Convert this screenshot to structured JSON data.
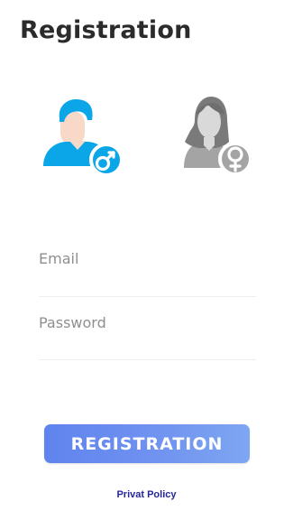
{
  "screen": {
    "title": "Registration"
  },
  "gender": {
    "male": {
      "icon": "male-avatar-icon",
      "badge_icon": "male-symbol-icon",
      "color": "#00a7e8"
    },
    "female": {
      "icon": "female-avatar-icon",
      "badge_icon": "female-symbol-icon",
      "color": "#a1a1a1"
    }
  },
  "form": {
    "email": {
      "placeholder": "Email",
      "value": ""
    },
    "password": {
      "placeholder": "Password",
      "value": ""
    },
    "submit_label": "REGISTRATION"
  },
  "footer": {
    "privacy_label": "Privat Policy",
    "link_color": "#24269a"
  },
  "theme": {
    "button_gradient_start": "#5f84ee",
    "button_gradient_end": "#7ea6f1",
    "title_color": "#2b2b2b"
  }
}
